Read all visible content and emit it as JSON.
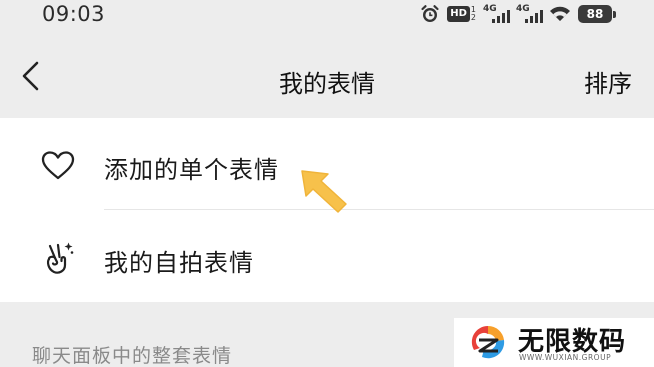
{
  "status_bar": {
    "time": "09:03",
    "hd_label": "HD",
    "hd_digits": [
      "1",
      "2"
    ],
    "signal_1_label": "4G",
    "signal_2_label": "4G",
    "battery": "88"
  },
  "header": {
    "title": "我的表情",
    "sort_label": "排序",
    "back_icon": "chevron-left-icon"
  },
  "list": {
    "items": [
      {
        "label": "添加的单个表情",
        "icon": "heart-outline-icon"
      },
      {
        "label": "我的自拍表情",
        "icon": "victory-hand-icon"
      }
    ]
  },
  "section_header": "聊天面板中的整套表情",
  "annotation": {
    "icon": "pointer-arrow-icon",
    "color": "#f7c14b"
  },
  "watermark": {
    "brand": "无限数码",
    "url": "WWW.WUXIAN.GROUP"
  },
  "colors": {
    "background": "#ededed",
    "card": "#ffffff",
    "text": "#1a1a1a",
    "section_text": "#8a8a8a",
    "arrow": "#f7c14b"
  }
}
